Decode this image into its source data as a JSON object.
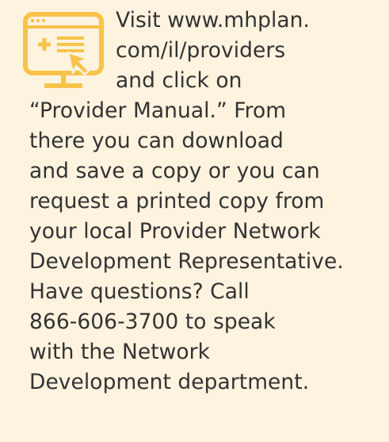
{
  "icon": {
    "name": "computer-click-icon",
    "color": "#f7c34b"
  },
  "message": {
    "lines": [
      "Visit www.mhplan.",
      "com/il/providers",
      "and click on",
      "“Provider Manual.” From",
      "there you can download",
      "and save a copy or you can",
      "request a printed copy from",
      "your local Provider Network",
      "Development Representative.",
      "Have questions? Call",
      "866-606-3700 to speak",
      "with the Network",
      "Development department."
    ]
  },
  "colors": {
    "background": "#fdf3df",
    "text": "#333333",
    "accent": "#f7c34b"
  }
}
